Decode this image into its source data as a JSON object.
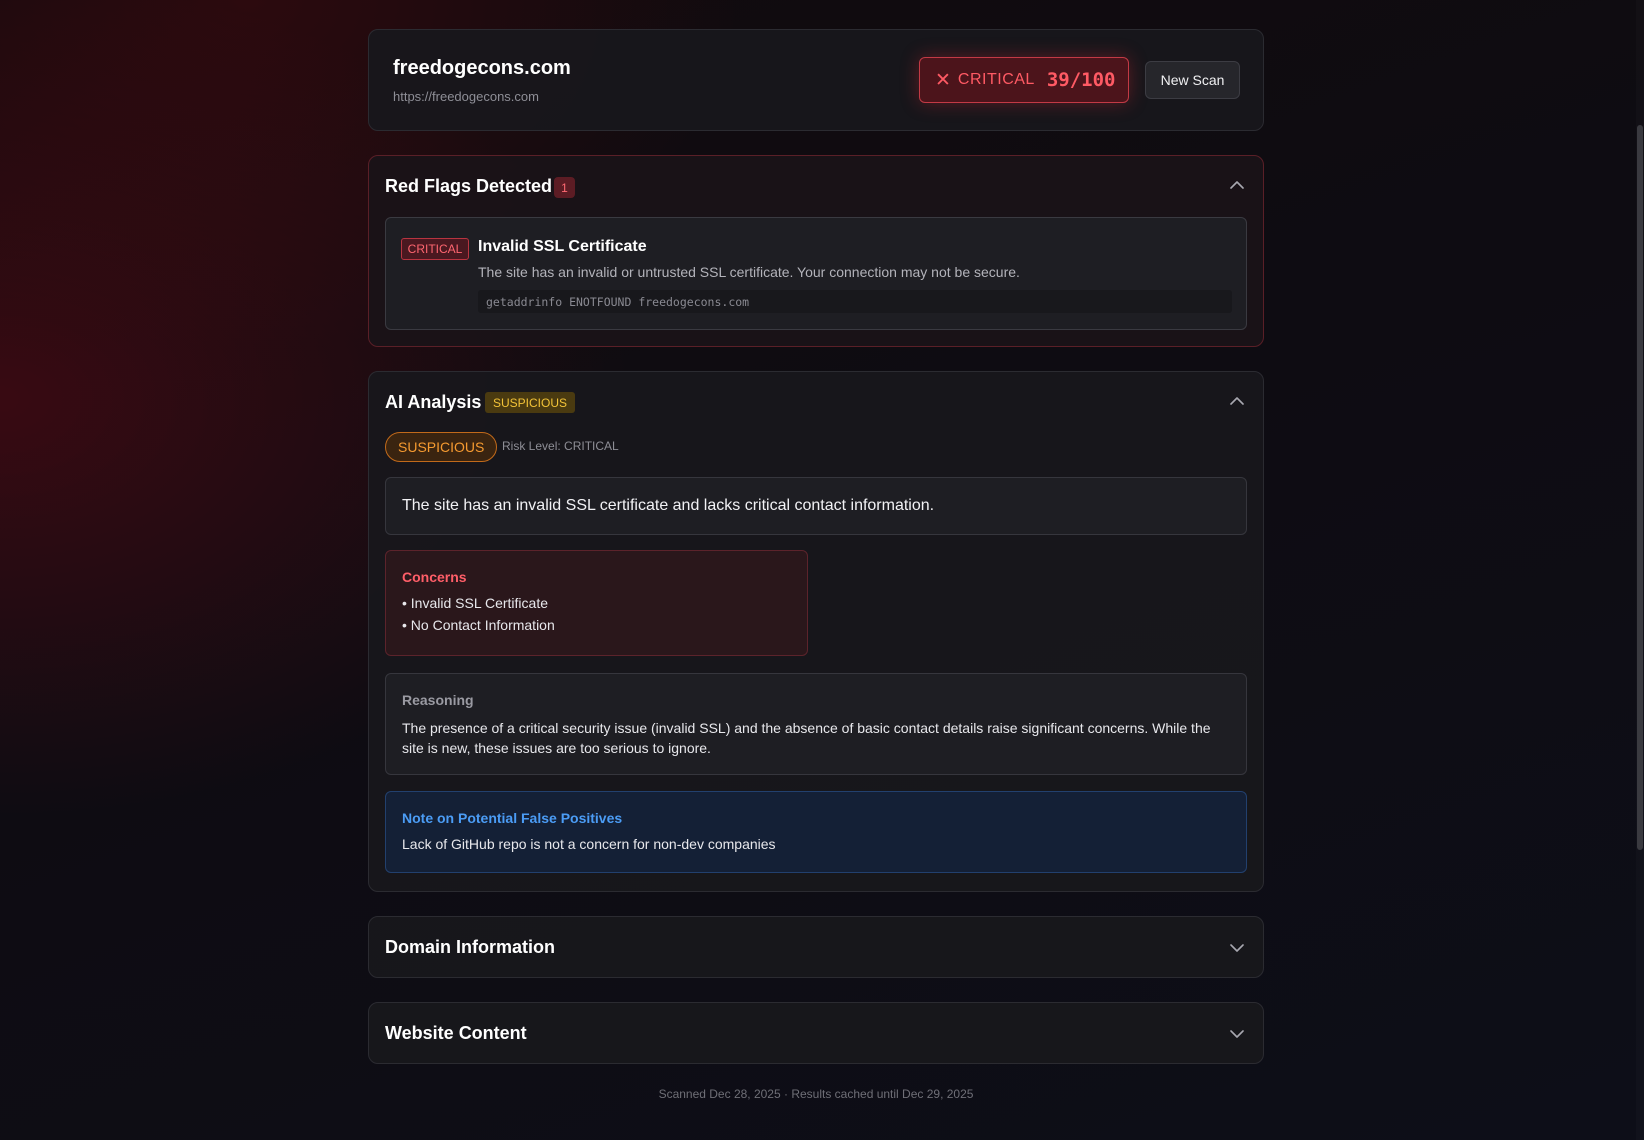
{
  "header": {
    "site_name": "freedogecons.com",
    "site_url": "https://freedogecons.com",
    "score_label": "CRITICAL",
    "score": "39/100",
    "new_scan_label": "New Scan"
  },
  "red_flags": {
    "title": "Red Flags Detected",
    "count": "1",
    "items": [
      {
        "severity": "CRITICAL",
        "title": "Invalid SSL Certificate",
        "description": "The site has an invalid or untrusted SSL certificate. Your connection may not be secure.",
        "detail": "getaddrinfo ENOTFOUND freedogecons.com"
      }
    ]
  },
  "ai_analysis": {
    "title": "AI Analysis",
    "verdict_tag": "SUSPICIOUS",
    "verdict": "SUSPICIOUS",
    "risk_level": "Risk Level: CRITICAL",
    "summary": "The site has an invalid SSL certificate and lacks critical contact information.",
    "concerns_title": "Concerns",
    "concerns": [
      "• Invalid SSL Certificate",
      "• No Contact Information"
    ],
    "reasoning_title": "Reasoning",
    "reasoning": "The presence of a critical security issue (invalid SSL) and the absence of basic contact details raise significant concerns. While the site is new, these issues are too serious to ignore.",
    "note_title": "Note on Potential False Positives",
    "note": "Lack of GitHub repo is not a concern for non-dev companies"
  },
  "domain_info": {
    "title": "Domain Information"
  },
  "website_content": {
    "title": "Website Content"
  },
  "footer": {
    "text": "Scanned Dec 28, 2025 · Results cached until Dec 29, 2025"
  },
  "colors": {
    "critical": "#ff5a64",
    "suspicious": "#f59a30",
    "note_blue": "#4b9cf5"
  }
}
